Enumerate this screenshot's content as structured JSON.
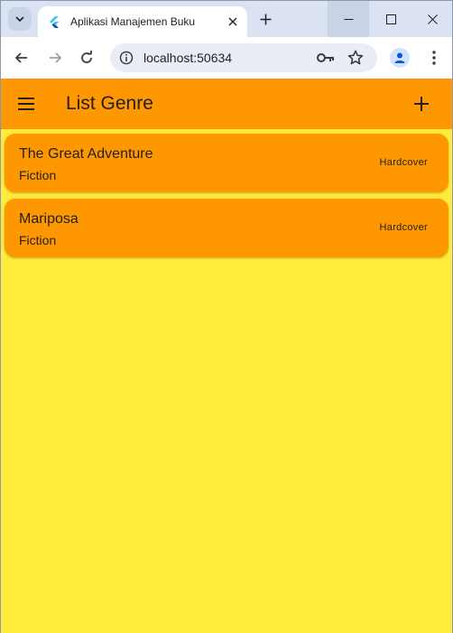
{
  "browser": {
    "tab": {
      "title": "Aplikasi Manajemen Buku"
    },
    "address": {
      "url": "localhost:50634"
    }
  },
  "app": {
    "appbar": {
      "title": "List Genre"
    },
    "books": [
      {
        "title": "The Great Adventure",
        "genre": "Fiction",
        "format": "Hardcover"
      },
      {
        "title": "Mariposa",
        "genre": "Fiction",
        "format": "Hardcover"
      }
    ],
    "colors": {
      "appbar": "#ff9800",
      "background": "#ffeb3b",
      "card": "#ff9800"
    }
  },
  "icons": {
    "tab_search": "chevron-down-icon",
    "favicon": "flutter-icon",
    "close": "close-icon",
    "new_tab": "plus-icon",
    "back": "arrow-left-icon",
    "forward": "arrow-right-icon",
    "reload": "reload-icon",
    "info": "info-icon",
    "password": "key-icon",
    "bookmark": "star-icon",
    "profile": "profile-icon",
    "menu": "more-vert-icon",
    "drawer": "hamburger-icon",
    "add": "plus-icon"
  }
}
